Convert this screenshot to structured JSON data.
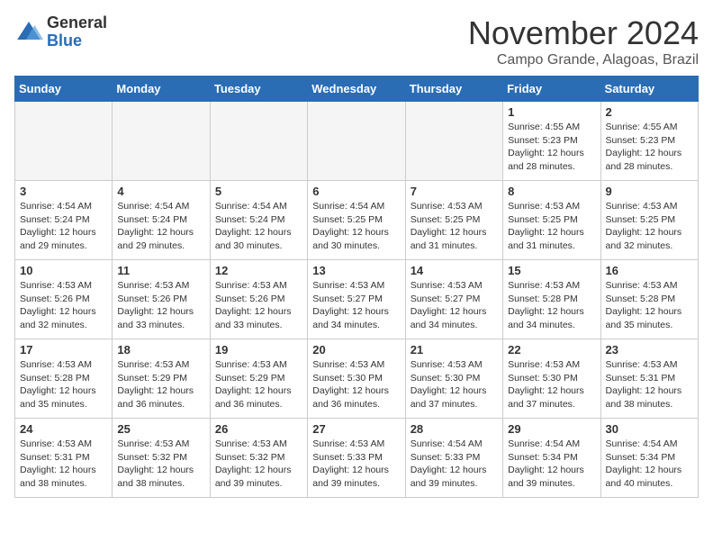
{
  "header": {
    "logo_general": "General",
    "logo_blue": "Blue",
    "title": "November 2024",
    "subtitle": "Campo Grande, Alagoas, Brazil"
  },
  "weekdays": [
    "Sunday",
    "Monday",
    "Tuesday",
    "Wednesday",
    "Thursday",
    "Friday",
    "Saturday"
  ],
  "weeks": [
    [
      {
        "day": "",
        "info": ""
      },
      {
        "day": "",
        "info": ""
      },
      {
        "day": "",
        "info": ""
      },
      {
        "day": "",
        "info": ""
      },
      {
        "day": "",
        "info": ""
      },
      {
        "day": "1",
        "info": "Sunrise: 4:55 AM\nSunset: 5:23 PM\nDaylight: 12 hours and 28 minutes."
      },
      {
        "day": "2",
        "info": "Sunrise: 4:55 AM\nSunset: 5:23 PM\nDaylight: 12 hours and 28 minutes."
      }
    ],
    [
      {
        "day": "3",
        "info": "Sunrise: 4:54 AM\nSunset: 5:24 PM\nDaylight: 12 hours and 29 minutes."
      },
      {
        "day": "4",
        "info": "Sunrise: 4:54 AM\nSunset: 5:24 PM\nDaylight: 12 hours and 29 minutes."
      },
      {
        "day": "5",
        "info": "Sunrise: 4:54 AM\nSunset: 5:24 PM\nDaylight: 12 hours and 30 minutes."
      },
      {
        "day": "6",
        "info": "Sunrise: 4:54 AM\nSunset: 5:25 PM\nDaylight: 12 hours and 30 minutes."
      },
      {
        "day": "7",
        "info": "Sunrise: 4:53 AM\nSunset: 5:25 PM\nDaylight: 12 hours and 31 minutes."
      },
      {
        "day": "8",
        "info": "Sunrise: 4:53 AM\nSunset: 5:25 PM\nDaylight: 12 hours and 31 minutes."
      },
      {
        "day": "9",
        "info": "Sunrise: 4:53 AM\nSunset: 5:25 PM\nDaylight: 12 hours and 32 minutes."
      }
    ],
    [
      {
        "day": "10",
        "info": "Sunrise: 4:53 AM\nSunset: 5:26 PM\nDaylight: 12 hours and 32 minutes."
      },
      {
        "day": "11",
        "info": "Sunrise: 4:53 AM\nSunset: 5:26 PM\nDaylight: 12 hours and 33 minutes."
      },
      {
        "day": "12",
        "info": "Sunrise: 4:53 AM\nSunset: 5:26 PM\nDaylight: 12 hours and 33 minutes."
      },
      {
        "day": "13",
        "info": "Sunrise: 4:53 AM\nSunset: 5:27 PM\nDaylight: 12 hours and 34 minutes."
      },
      {
        "day": "14",
        "info": "Sunrise: 4:53 AM\nSunset: 5:27 PM\nDaylight: 12 hours and 34 minutes."
      },
      {
        "day": "15",
        "info": "Sunrise: 4:53 AM\nSunset: 5:28 PM\nDaylight: 12 hours and 34 minutes."
      },
      {
        "day": "16",
        "info": "Sunrise: 4:53 AM\nSunset: 5:28 PM\nDaylight: 12 hours and 35 minutes."
      }
    ],
    [
      {
        "day": "17",
        "info": "Sunrise: 4:53 AM\nSunset: 5:28 PM\nDaylight: 12 hours and 35 minutes."
      },
      {
        "day": "18",
        "info": "Sunrise: 4:53 AM\nSunset: 5:29 PM\nDaylight: 12 hours and 36 minutes."
      },
      {
        "day": "19",
        "info": "Sunrise: 4:53 AM\nSunset: 5:29 PM\nDaylight: 12 hours and 36 minutes."
      },
      {
        "day": "20",
        "info": "Sunrise: 4:53 AM\nSunset: 5:30 PM\nDaylight: 12 hours and 36 minutes."
      },
      {
        "day": "21",
        "info": "Sunrise: 4:53 AM\nSunset: 5:30 PM\nDaylight: 12 hours and 37 minutes."
      },
      {
        "day": "22",
        "info": "Sunrise: 4:53 AM\nSunset: 5:30 PM\nDaylight: 12 hours and 37 minutes."
      },
      {
        "day": "23",
        "info": "Sunrise: 4:53 AM\nSunset: 5:31 PM\nDaylight: 12 hours and 38 minutes."
      }
    ],
    [
      {
        "day": "24",
        "info": "Sunrise: 4:53 AM\nSunset: 5:31 PM\nDaylight: 12 hours and 38 minutes."
      },
      {
        "day": "25",
        "info": "Sunrise: 4:53 AM\nSunset: 5:32 PM\nDaylight: 12 hours and 38 minutes."
      },
      {
        "day": "26",
        "info": "Sunrise: 4:53 AM\nSunset: 5:32 PM\nDaylight: 12 hours and 39 minutes."
      },
      {
        "day": "27",
        "info": "Sunrise: 4:53 AM\nSunset: 5:33 PM\nDaylight: 12 hours and 39 minutes."
      },
      {
        "day": "28",
        "info": "Sunrise: 4:54 AM\nSunset: 5:33 PM\nDaylight: 12 hours and 39 minutes."
      },
      {
        "day": "29",
        "info": "Sunrise: 4:54 AM\nSunset: 5:34 PM\nDaylight: 12 hours and 39 minutes."
      },
      {
        "day": "30",
        "info": "Sunrise: 4:54 AM\nSunset: 5:34 PM\nDaylight: 12 hours and 40 minutes."
      }
    ]
  ]
}
